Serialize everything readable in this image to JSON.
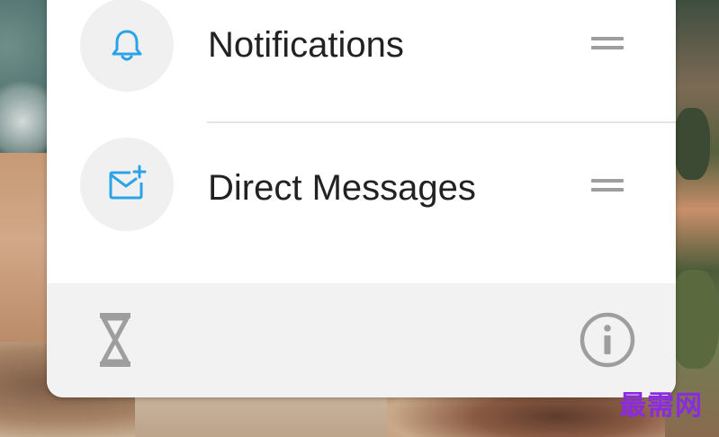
{
  "items": [
    {
      "label": "Notifications",
      "icon": "bell-icon"
    },
    {
      "label": "Direct Messages",
      "icon": "mail-plus-icon"
    }
  ],
  "footer": {
    "left_icon": "hourglass-icon",
    "right_icon": "info-icon"
  },
  "watermark": "最需网",
  "colors": {
    "accent": "#2aa3e8",
    "icon_circle_bg": "#f0f0f0",
    "footer_bg": "#f2f2f2",
    "footer_icon": "#9e9e9e",
    "text": "#222222"
  }
}
